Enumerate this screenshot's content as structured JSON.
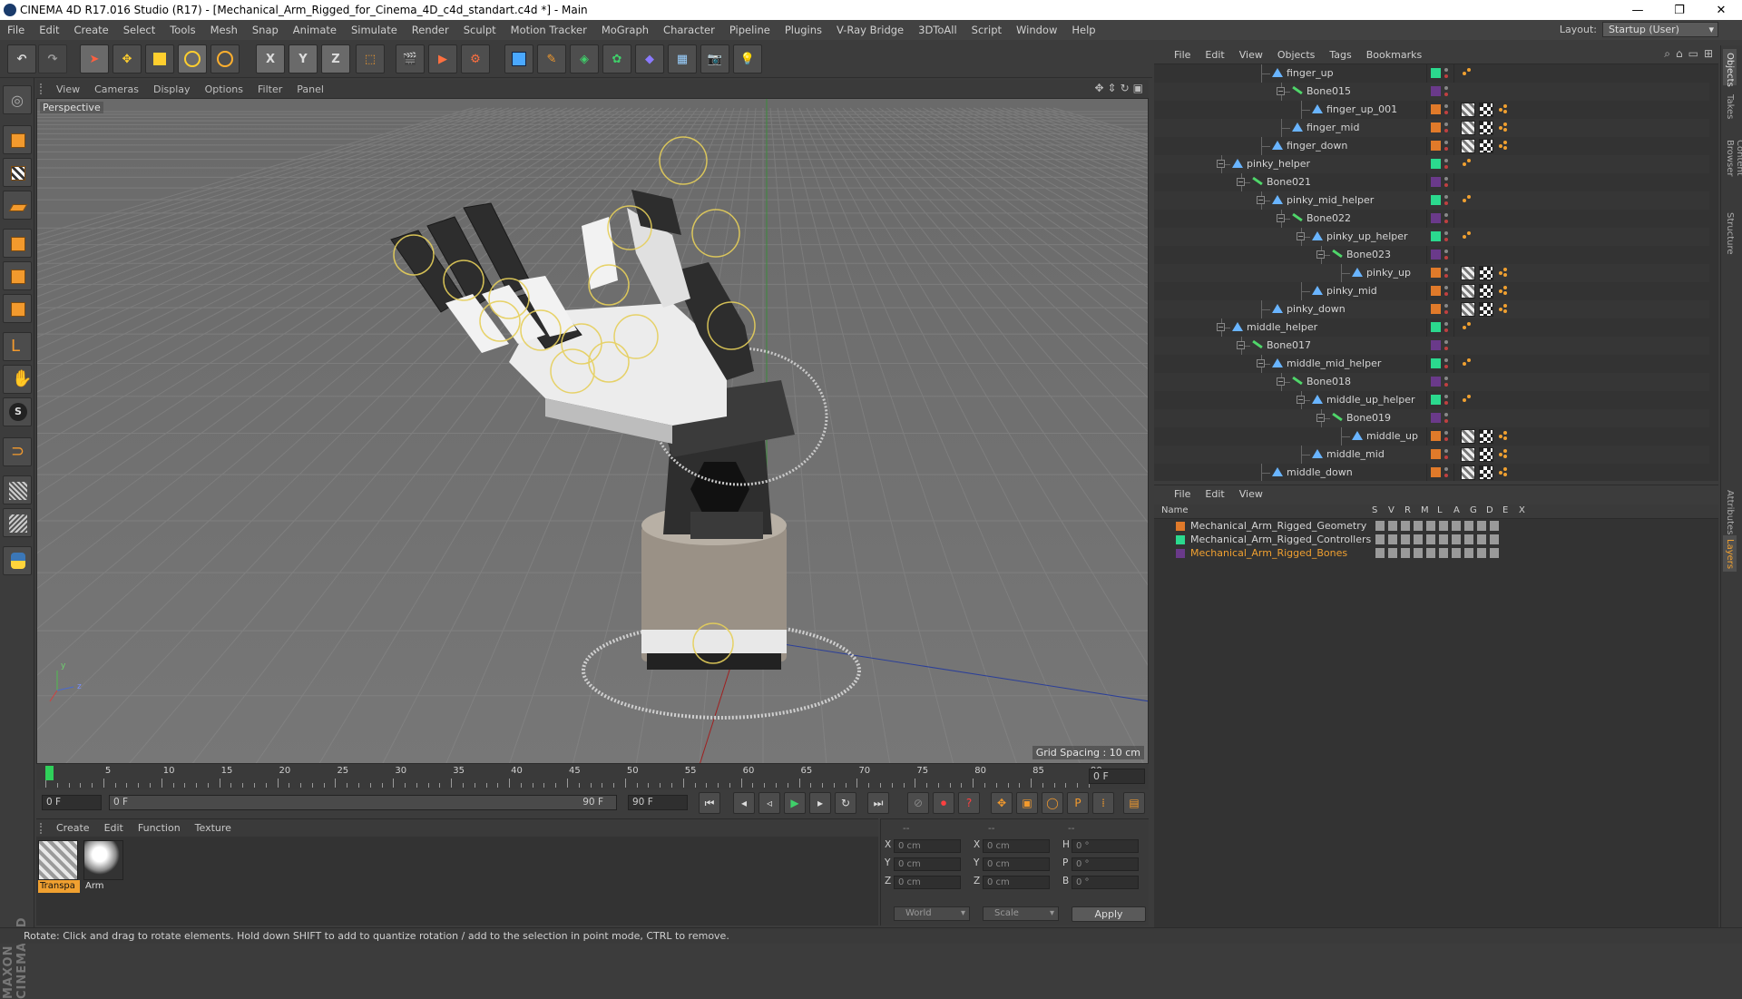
{
  "window": {
    "title": "CINEMA 4D R17.016 Studio (R17) - [Mechanical_Arm_Rigged_for_Cinema_4D_c4d_standart.c4d *] - Main",
    "minimize": "—",
    "maximize": "❐",
    "close": "✕"
  },
  "menubar": {
    "items": [
      "File",
      "Edit",
      "Create",
      "Select",
      "Tools",
      "Mesh",
      "Snap",
      "Animate",
      "Simulate",
      "Render",
      "Sculpt",
      "Motion Tracker",
      "MoGraph",
      "Character",
      "Pipeline",
      "Plugins",
      "V-Ray Bridge",
      "3DToAll",
      "Script",
      "Window",
      "Help"
    ],
    "layout_label": "Layout:",
    "layout_value": "Startup (User)"
  },
  "toolbar": {
    "x_label": "X",
    "y_label": "Y",
    "z_label": "Z"
  },
  "viewport": {
    "menu": [
      "View",
      "Cameras",
      "Display",
      "Options",
      "Filter",
      "Panel"
    ],
    "label": "Perspective",
    "grid_spacing": "Grid Spacing : 10 cm",
    "axis_y": "y",
    "axis_z": "z"
  },
  "timeline": {
    "ticks": [
      "0",
      "5",
      "10",
      "15",
      "20",
      "25",
      "30",
      "35",
      "40",
      "45",
      "50",
      "55",
      "60",
      "65",
      "70",
      "75",
      "80",
      "85",
      "90"
    ],
    "current_frame": "0 F"
  },
  "transport": {
    "start": "0 F",
    "min": "0 F",
    "max": "90 F",
    "end": "90 F"
  },
  "material_manager": {
    "menu": [
      "Create",
      "Edit",
      "Function",
      "Texture"
    ],
    "materials": [
      {
        "name": "Transpa",
        "selected": true
      },
      {
        "name": "Arm",
        "selected": false
      }
    ]
  },
  "coordinates": {
    "headers": [
      "--",
      "--",
      "--"
    ],
    "rows": [
      {
        "a": "X",
        "av": "0 cm",
        "b": "X",
        "bv": "0 cm",
        "c": "H",
        "cv": "0 °"
      },
      {
        "a": "Y",
        "av": "0 cm",
        "b": "Y",
        "bv": "0 cm",
        "c": "P",
        "cv": "0 °"
      },
      {
        "a": "Z",
        "av": "0 cm",
        "b": "Z",
        "bv": "0 cm",
        "c": "B",
        "cv": "0 °"
      }
    ],
    "world": "World",
    "scale": "Scale",
    "apply": "Apply"
  },
  "status": "Rotate: Click and drag to rotate elements. Hold down SHIFT to add to quantize rotation / add to the selection in point mode, CTRL to remove.",
  "object_manager": {
    "menu": [
      "File",
      "Edit",
      "View",
      "Objects",
      "Tags",
      "Bookmarks"
    ],
    "objects": [
      {
        "name": "finger_up",
        "type": "joint",
        "level": 5,
        "layer": "#2bd98e",
        "tags": "dot"
      },
      {
        "name": "Bone015",
        "type": "bone",
        "level": 6,
        "layer": "#6a3a8a",
        "tags": ""
      },
      {
        "name": "finger_up_001",
        "type": "joint",
        "level": 7,
        "layer": "#e07a2a",
        "tags": "full"
      },
      {
        "name": "finger_mid",
        "type": "joint",
        "level": 6,
        "layer": "#e07a2a",
        "tags": "full"
      },
      {
        "name": "finger_down",
        "type": "joint",
        "level": 5,
        "layer": "#e07a2a",
        "tags": "full"
      },
      {
        "name": "pinky_helper",
        "type": "joint",
        "level": 3,
        "layer": "#2bd98e",
        "tags": "dot"
      },
      {
        "name": "Bone021",
        "type": "bone",
        "level": 4,
        "layer": "#6a3a8a",
        "tags": ""
      },
      {
        "name": "pinky_mid_helper",
        "type": "joint",
        "level": 5,
        "layer": "#2bd98e",
        "tags": "dot"
      },
      {
        "name": "Bone022",
        "type": "bone",
        "level": 6,
        "layer": "#6a3a8a",
        "tags": ""
      },
      {
        "name": "pinky_up_helper",
        "type": "joint",
        "level": 7,
        "layer": "#2bd98e",
        "tags": "dot"
      },
      {
        "name": "Bone023",
        "type": "bone",
        "level": 8,
        "layer": "#6a3a8a",
        "tags": ""
      },
      {
        "name": "pinky_up",
        "type": "joint",
        "level": 9,
        "layer": "#e07a2a",
        "tags": "full"
      },
      {
        "name": "pinky_mid",
        "type": "joint",
        "level": 7,
        "layer": "#e07a2a",
        "tags": "full"
      },
      {
        "name": "pinky_down",
        "type": "joint",
        "level": 5,
        "layer": "#e07a2a",
        "tags": "full"
      },
      {
        "name": "middle_helper",
        "type": "joint",
        "level": 3,
        "layer": "#2bd98e",
        "tags": "dot"
      },
      {
        "name": "Bone017",
        "type": "bone",
        "level": 4,
        "layer": "#6a3a8a",
        "tags": ""
      },
      {
        "name": "middle_mid_helper",
        "type": "joint",
        "level": 5,
        "layer": "#2bd98e",
        "tags": "dot"
      },
      {
        "name": "Bone018",
        "type": "bone",
        "level": 6,
        "layer": "#6a3a8a",
        "tags": ""
      },
      {
        "name": "middle_up_helper",
        "type": "joint",
        "level": 7,
        "layer": "#2bd98e",
        "tags": "dot"
      },
      {
        "name": "Bone019",
        "type": "bone",
        "level": 8,
        "layer": "#6a3a8a",
        "tags": ""
      },
      {
        "name": "middle_up",
        "type": "joint",
        "level": 9,
        "layer": "#e07a2a",
        "tags": "full"
      },
      {
        "name": "middle_mid",
        "type": "joint",
        "level": 7,
        "layer": "#e07a2a",
        "tags": "full"
      },
      {
        "name": "middle_down",
        "type": "joint",
        "level": 5,
        "layer": "#e07a2a",
        "tags": "full"
      }
    ]
  },
  "layer_manager": {
    "menu": [
      "File",
      "Edit",
      "View"
    ],
    "columns": [
      "Name",
      "S",
      "V",
      "R",
      "M",
      "L",
      "A",
      "G",
      "D",
      "E",
      "X"
    ],
    "layers": [
      {
        "name": "Mechanical_Arm_Rigged_Geometry",
        "color": "#e07a2a",
        "text_color": "#d4d4d4"
      },
      {
        "name": "Mechanical_Arm_Rigged_Controllers",
        "color": "#2bd98e",
        "text_color": "#d4d4d4"
      },
      {
        "name": "Mechanical_Arm_Rigged_Bones",
        "color": "#6a3a8a",
        "text_color": "#f0a030"
      }
    ]
  },
  "side_tabs": [
    "Objects",
    "Takes",
    "Content Browser",
    "Structure",
    "Attributes",
    "Layers"
  ],
  "maxon": "MAXON CINEMA 4D"
}
